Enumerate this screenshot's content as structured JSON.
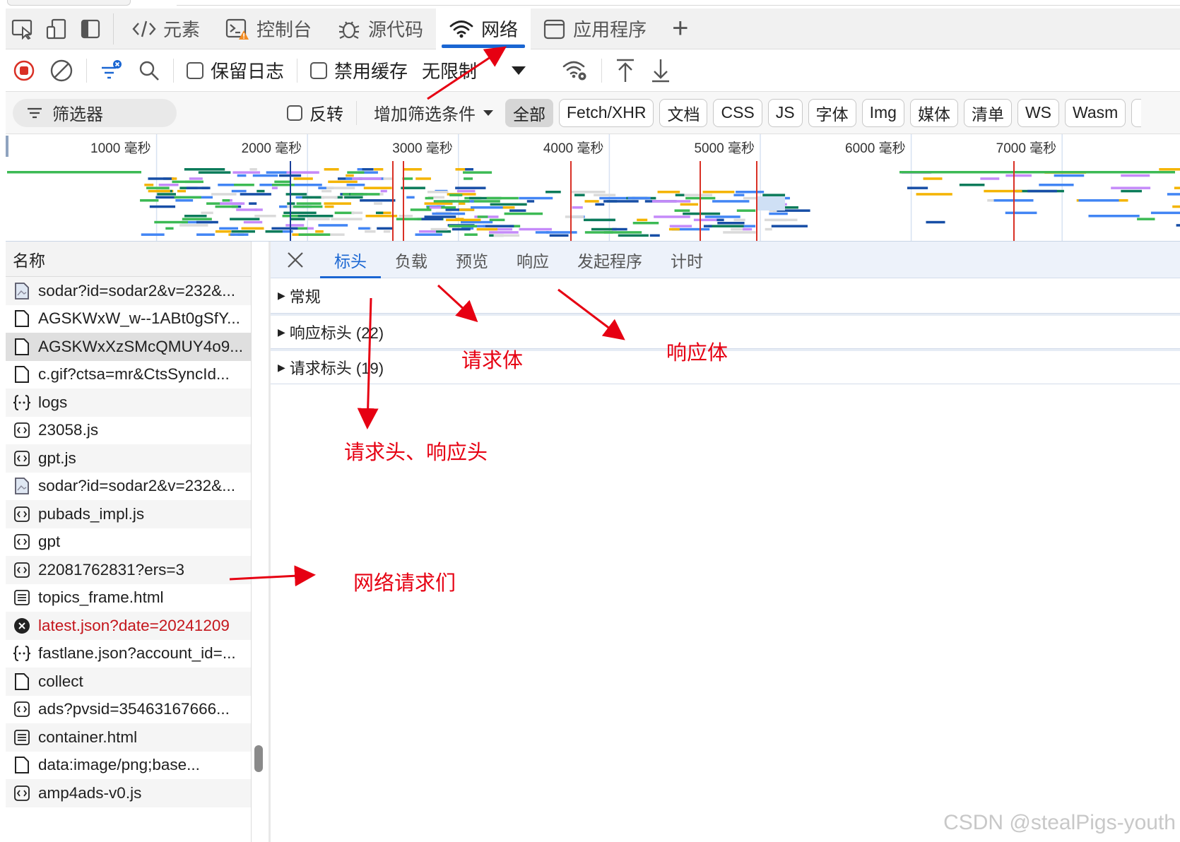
{
  "devtools": {
    "main_tabs": [
      {
        "label": "元素",
        "icon": "code-icon"
      },
      {
        "label": "控制台",
        "icon": "console-icon"
      },
      {
        "label": "源代码",
        "icon": "bug-icon"
      },
      {
        "label": "网络",
        "icon": "wifi-icon",
        "active": true
      },
      {
        "label": "应用程序",
        "icon": "storage-icon"
      }
    ],
    "toolbar": {
      "preserve_log": "保留日志",
      "disable_cache": "禁用缓存",
      "throttling": "无限制"
    },
    "filter": {
      "placeholder": "筛选器",
      "invert": "反转",
      "add_filter": "增加筛选条件",
      "chips": [
        "全部",
        "Fetch/XHR",
        "文档",
        "CSS",
        "JS",
        "字体",
        "Img",
        "媒体",
        "清单",
        "WS",
        "Wasm"
      ]
    },
    "timeline": {
      "ticks": [
        "1000 毫秒",
        "2000 毫秒",
        "3000 毫秒",
        "4000 毫秒",
        "5000 毫秒",
        "6000 毫秒",
        "7000 毫秒"
      ]
    },
    "request_list": {
      "header": "名称",
      "items": [
        {
          "name": "sodar?id=sodar2&v=232&...",
          "icon": "image-file-icon"
        },
        {
          "name": "AGSKWxW_w--1ABt0gSfY...",
          "icon": "file-icon"
        },
        {
          "name": "AGSKWxXzSMcQMUY4o9...",
          "icon": "file-icon",
          "selected": true
        },
        {
          "name": "c.gif?ctsa=mr&CtsSyncId...",
          "icon": "file-icon"
        },
        {
          "name": "logs",
          "icon": "json-icon"
        },
        {
          "name": "23058.js",
          "icon": "script-icon"
        },
        {
          "name": "gpt.js",
          "icon": "script-icon"
        },
        {
          "name": "sodar?id=sodar2&v=232&...",
          "icon": "image-file-icon"
        },
        {
          "name": "pubads_impl.js",
          "icon": "script-icon"
        },
        {
          "name": "gpt",
          "icon": "script-icon"
        },
        {
          "name": "22081762831?ers=3",
          "icon": "script-icon"
        },
        {
          "name": "topics_frame.html",
          "icon": "document-icon"
        },
        {
          "name": "latest.json?date=20241209",
          "icon": "error-icon",
          "error": true
        },
        {
          "name": "fastlane.json?account_id=...",
          "icon": "json-icon"
        },
        {
          "name": "collect",
          "icon": "file-icon"
        },
        {
          "name": "ads?pvsid=35463167666...",
          "icon": "script-icon"
        },
        {
          "name": "container.html",
          "icon": "document-icon"
        },
        {
          "name": "data:image/png;base...",
          "icon": "file-icon"
        },
        {
          "name": "amp4ads-v0.js",
          "icon": "script-icon"
        }
      ]
    },
    "detail": {
      "tabs": [
        "标头",
        "负载",
        "预览",
        "响应",
        "发起程序",
        "计时"
      ],
      "sections": [
        {
          "label": "常规"
        },
        {
          "label": "响应标头 (22)"
        },
        {
          "label": "请求标头 (19)"
        }
      ]
    }
  },
  "annotations": {
    "request_body": "请求体",
    "response_body": "响应体",
    "headers": "请求头、响应头",
    "requests": "网络请求们"
  },
  "watermark": "CSDN @stealPigs-youth",
  "colors": {
    "accent": "#1a66d2",
    "annotation": "#e60012",
    "error": "#c4161c"
  }
}
